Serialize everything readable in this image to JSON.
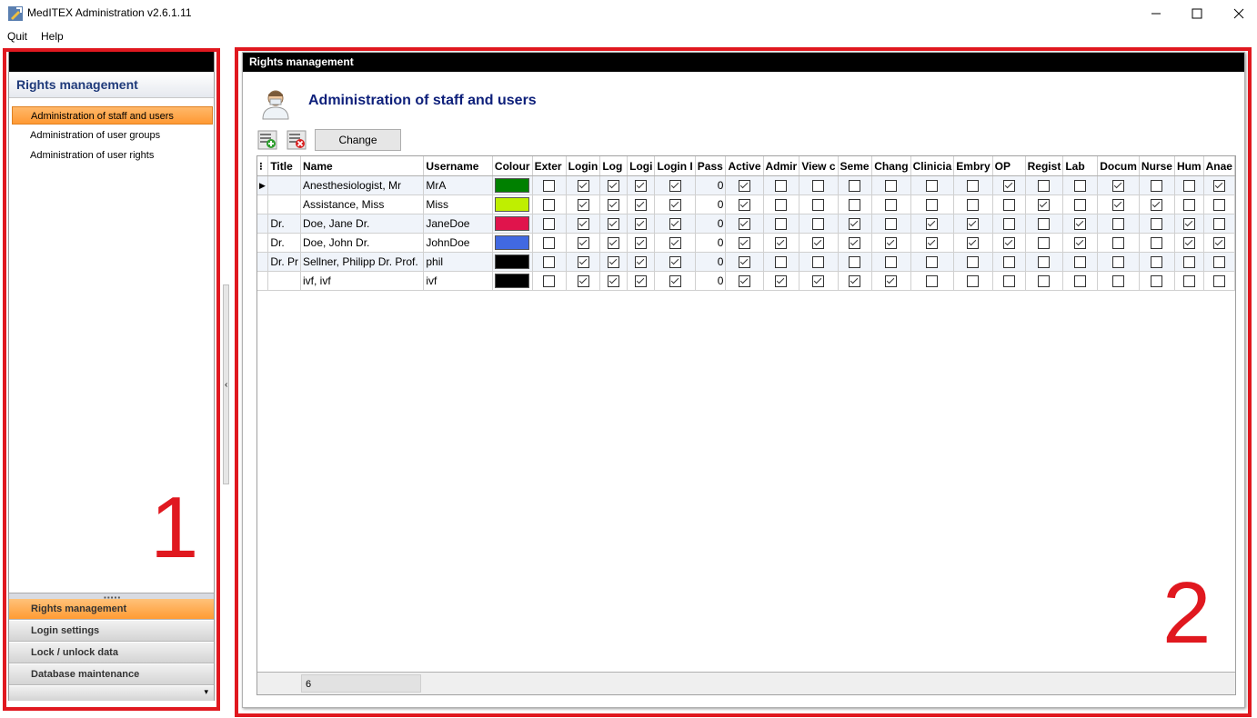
{
  "window": {
    "title": "MedITEX Administration v2.6.1.11"
  },
  "menu": {
    "items": [
      "Quit",
      "Help"
    ]
  },
  "sidebar": {
    "header": "Rights management",
    "items": [
      {
        "label": "Administration of staff and users",
        "active": true
      },
      {
        "label": "Administration of user groups",
        "active": false
      },
      {
        "label": "Administration of user rights",
        "active": false
      }
    ],
    "sections": [
      {
        "label": "Rights management",
        "active": true
      },
      {
        "label": "Login settings",
        "active": false
      },
      {
        "label": "Lock / unlock data",
        "active": false
      },
      {
        "label": "Database maintenance",
        "active": false
      }
    ]
  },
  "annotations": {
    "one": "1",
    "two": "2"
  },
  "main": {
    "panel_title": "Rights management",
    "page_title": "Administration of staff and users",
    "change_label": "Change",
    "row_count": "6",
    "columns": [
      "Title",
      "Name",
      "Username",
      "Colour",
      "Exter",
      "Login",
      "Log",
      "Logi",
      "Login I",
      "Pass",
      "Active",
      "Admir",
      "View c",
      "Seme",
      "Chang",
      "Clinicia",
      "Embry",
      "OP",
      "Regist",
      "Lab",
      "Docum",
      "Nurse",
      "Hum",
      "Anae"
    ],
    "rows": [
      {
        "title": "",
        "name": "Anesthesiologist, Mr",
        "username": "MrA",
        "colour": "#008000",
        "pass": "0",
        "flags": [
          false,
          true,
          true,
          true,
          true,
          true,
          false,
          false,
          false,
          false,
          false,
          false,
          true,
          false,
          false,
          true,
          false,
          false,
          true
        ]
      },
      {
        "title": "",
        "name": "Assistance, Miss",
        "username": "Miss",
        "colour": "#bfef00",
        "pass": "0",
        "flags": [
          false,
          true,
          true,
          true,
          true,
          true,
          false,
          false,
          false,
          false,
          false,
          false,
          false,
          true,
          false,
          true,
          true,
          false,
          false
        ]
      },
      {
        "title": "Dr.",
        "name": "Doe, Jane Dr.",
        "username": "JaneDoe",
        "colour": "#e0144c",
        "pass": "0",
        "flags": [
          false,
          true,
          true,
          true,
          true,
          true,
          false,
          false,
          true,
          false,
          true,
          true,
          false,
          false,
          true,
          false,
          false,
          true,
          false
        ]
      },
      {
        "title": "Dr.",
        "name": "Doe, John Dr.",
        "username": "JohnDoe",
        "colour": "#4169e1",
        "pass": "0",
        "flags": [
          false,
          true,
          true,
          true,
          true,
          true,
          true,
          true,
          true,
          true,
          true,
          true,
          true,
          false,
          true,
          false,
          false,
          true,
          true
        ]
      },
      {
        "title": "Dr. Pr",
        "name": "Sellner, Philipp Dr. Prof.",
        "username": "phil",
        "colour": "#000000",
        "pass": "0",
        "flags": [
          false,
          true,
          true,
          true,
          true,
          true,
          false,
          false,
          false,
          false,
          false,
          false,
          false,
          false,
          false,
          false,
          false,
          false,
          false
        ]
      },
      {
        "title": "",
        "name": "ivf, ivf",
        "username": "ivf",
        "colour": "#000000",
        "pass": "0",
        "flags": [
          false,
          true,
          true,
          true,
          true,
          true,
          true,
          true,
          true,
          true,
          false,
          false,
          false,
          false,
          false,
          false,
          false,
          false,
          false
        ]
      }
    ]
  }
}
